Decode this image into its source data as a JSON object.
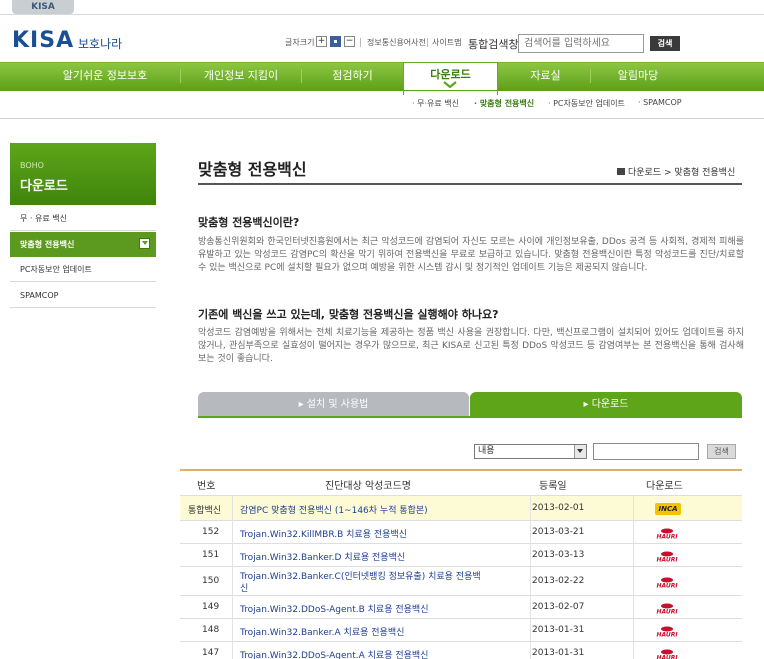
{
  "top_tab": "KISA",
  "logo": {
    "brand": "KISA",
    "service": "보호나라"
  },
  "util": {
    "font_size_label": "글자크기",
    "font_plus": "+",
    "font_minus": "−",
    "dictionary": "정보통신용어사전",
    "sitemap": "사이트맵",
    "search_label": "통합검색창",
    "search_placeholder": "검색어를 입력하세요",
    "search_button": "검색"
  },
  "gnb": [
    {
      "label": "알기쉬운 정보보호"
    },
    {
      "label": "개인정보 지킴이"
    },
    {
      "label": "점검하기"
    },
    {
      "label": "다운로드",
      "active": true
    },
    {
      "label": "자료실"
    },
    {
      "label": "알림마당"
    }
  ],
  "subnav": [
    {
      "label": "· 무·유료 백신"
    },
    {
      "label": "· 맞춤형 전용백신",
      "active": true
    },
    {
      "label": "· PC자동보안 업데이트"
    },
    {
      "label": "· SPAMCOP"
    }
  ],
  "lnb": {
    "en": "BOHO",
    "title": "다운로드",
    "items": [
      {
        "label": "무 · 유료 백신"
      },
      {
        "label": "맞춤형 전용백신",
        "active": true
      },
      {
        "label": "PC자동보안 업데이트"
      },
      {
        "label": "SPAMCOP"
      }
    ]
  },
  "page_title": "맞춤형 전용백신",
  "breadcrumb": {
    "parent": "다운로드",
    "sep": ">",
    "current": "맞춤형 전용백신"
  },
  "section1": {
    "heading": "맞춤형 전용백신이란?",
    "body": "방송통신위원회와 한국인터넷진흥원에서는 최근 악성코드에 감염되어 자신도 모르는 사이에 개인정보유출, DDos 공격 등 사회적, 경제적 피해를 유발하고 있는 악성코드 감염PC의 확산을 막기 위하여 전용백신을 무료로 보급하고 있습니다. 맞춤형 전용백신이란 특정 악성코드를 진단/치료할 수 있는 백신으로 PC에 설치할 필요가 없으며 예방을 위한 시스템 감시 및 정기적인 업데이트 기능은 제공되지 않습니다."
  },
  "section2": {
    "heading": "기존에 백신을 쓰고 있는데, 맞춤형 전용백신을 실행해야 하나요?",
    "body": "악성코드 감염예방을 위해서는 전체 치료기능을 제공하는 정품 백신 사용을 권장합니다. 다만, 백신프로그램이 설치되어 있어도 업데이트를 하지 않거나, 관심부족으로 실효성이 떨어지는 경우가 많으므로, 최근 KISA로 신고된 특정 DDoS 악성코드 등 감염여부는 본 전용백신을 통해 검사해 보는 것이 좋습니다."
  },
  "tabs": [
    {
      "label": "▸  설치 및 사용법"
    },
    {
      "label": "▸  다운로드",
      "active": true
    }
  ],
  "filter": {
    "select_value": "내용",
    "button": "검색"
  },
  "table": {
    "headers": [
      "번호",
      "진단대상 악성코드명",
      "등록일",
      "다운로드"
    ],
    "rows": [
      {
        "num": "통합백신",
        "name": "감염PC 맞춤형 전용백신 (1~146차 누적 통합본)",
        "date": "2013-02-01",
        "vendor": "INCA",
        "highlight": true
      },
      {
        "num": "152",
        "name": "Trojan.Win32.KillMBR.B 치료용 전용백신",
        "date": "2013-03-21",
        "vendor": "HAURI"
      },
      {
        "num": "151",
        "name": "Trojan.Win32.Banker.D 치료용 전용백신",
        "date": "2013-03-13",
        "vendor": "HAURI"
      },
      {
        "num": "150",
        "name": "Trojan.Win32.Banker.C(인터넷뱅킹 정보유출) 치료용 전용백",
        "name2": "신",
        "date": "2013-02-22",
        "vendor": "HAURI"
      },
      {
        "num": "149",
        "name": "Trojan.Win32.DDoS-Agent.B 치료용 전용백신",
        "date": "2013-02-07",
        "vendor": "HAURI"
      },
      {
        "num": "148",
        "name": "Trojan.Win32.Banker.A 치료용 전용백신",
        "date": "2013-01-31",
        "vendor": "HAURI"
      },
      {
        "num": "147",
        "name": "Trojan.Win32.DDoS-Agent.A 치료용 전용백신",
        "date": "2013-01-31",
        "vendor": "HAURI"
      }
    ]
  },
  "colors": {
    "green": "#5ea51a",
    "link": "#1f3f95",
    "highlight": "#fdfbd6",
    "hauri": "#c8102e"
  }
}
